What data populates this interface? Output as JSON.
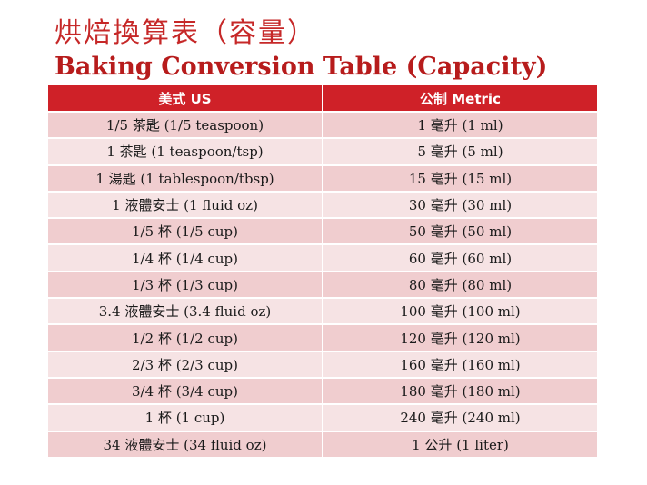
{
  "title_zh": "烘焙換算表（容量）",
  "title_en": "Baking Conversion Table (Capacity)",
  "table": {
    "headers": [
      "美式 US",
      "公制 Metric"
    ],
    "rows": [
      [
        "1/5 茶匙 (1/5 teaspoon)",
        "1 毫升 (1 ml)"
      ],
      [
        "1 茶匙 (1 teaspoon/tsp)",
        "5 毫升 (5 ml)"
      ],
      [
        "1 湯匙 (1 tablespoon/tbsp)",
        "15 毫升 (15 ml)"
      ],
      [
        "1 液體安士 (1 fluid oz)",
        "30 毫升 (30 ml)"
      ],
      [
        "1/5 杯 (1/5 cup)",
        "50 毫升 (50 ml)"
      ],
      [
        "1/4 杯 (1/4 cup)",
        "60 毫升 (60 ml)"
      ],
      [
        "1/3 杯 (1/3 cup)",
        "80 毫升 (80 ml)"
      ],
      [
        "3.4 液體安士 (3.4 fluid oz)",
        "100 毫升 (100 ml)"
      ],
      [
        "1/2 杯 (1/2 cup)",
        "120 毫升 (120 ml)"
      ],
      [
        "2/3 杯 (2/3 cup)",
        "160 毫升 (160 ml)"
      ],
      [
        "3/4 杯 (3/4 cup)",
        "180 毫升 (180 ml)"
      ],
      [
        "1 杯 (1 cup)",
        "240 毫升 (240 ml)"
      ],
      [
        "34 液體安士 (34 fluid oz)",
        "1 公升 (1 liter)"
      ]
    ]
  },
  "colors": {
    "title_red": "#c62828",
    "header_red": "#cf2128",
    "row_dark": "#f0cdcf",
    "row_light": "#f6e3e4"
  }
}
